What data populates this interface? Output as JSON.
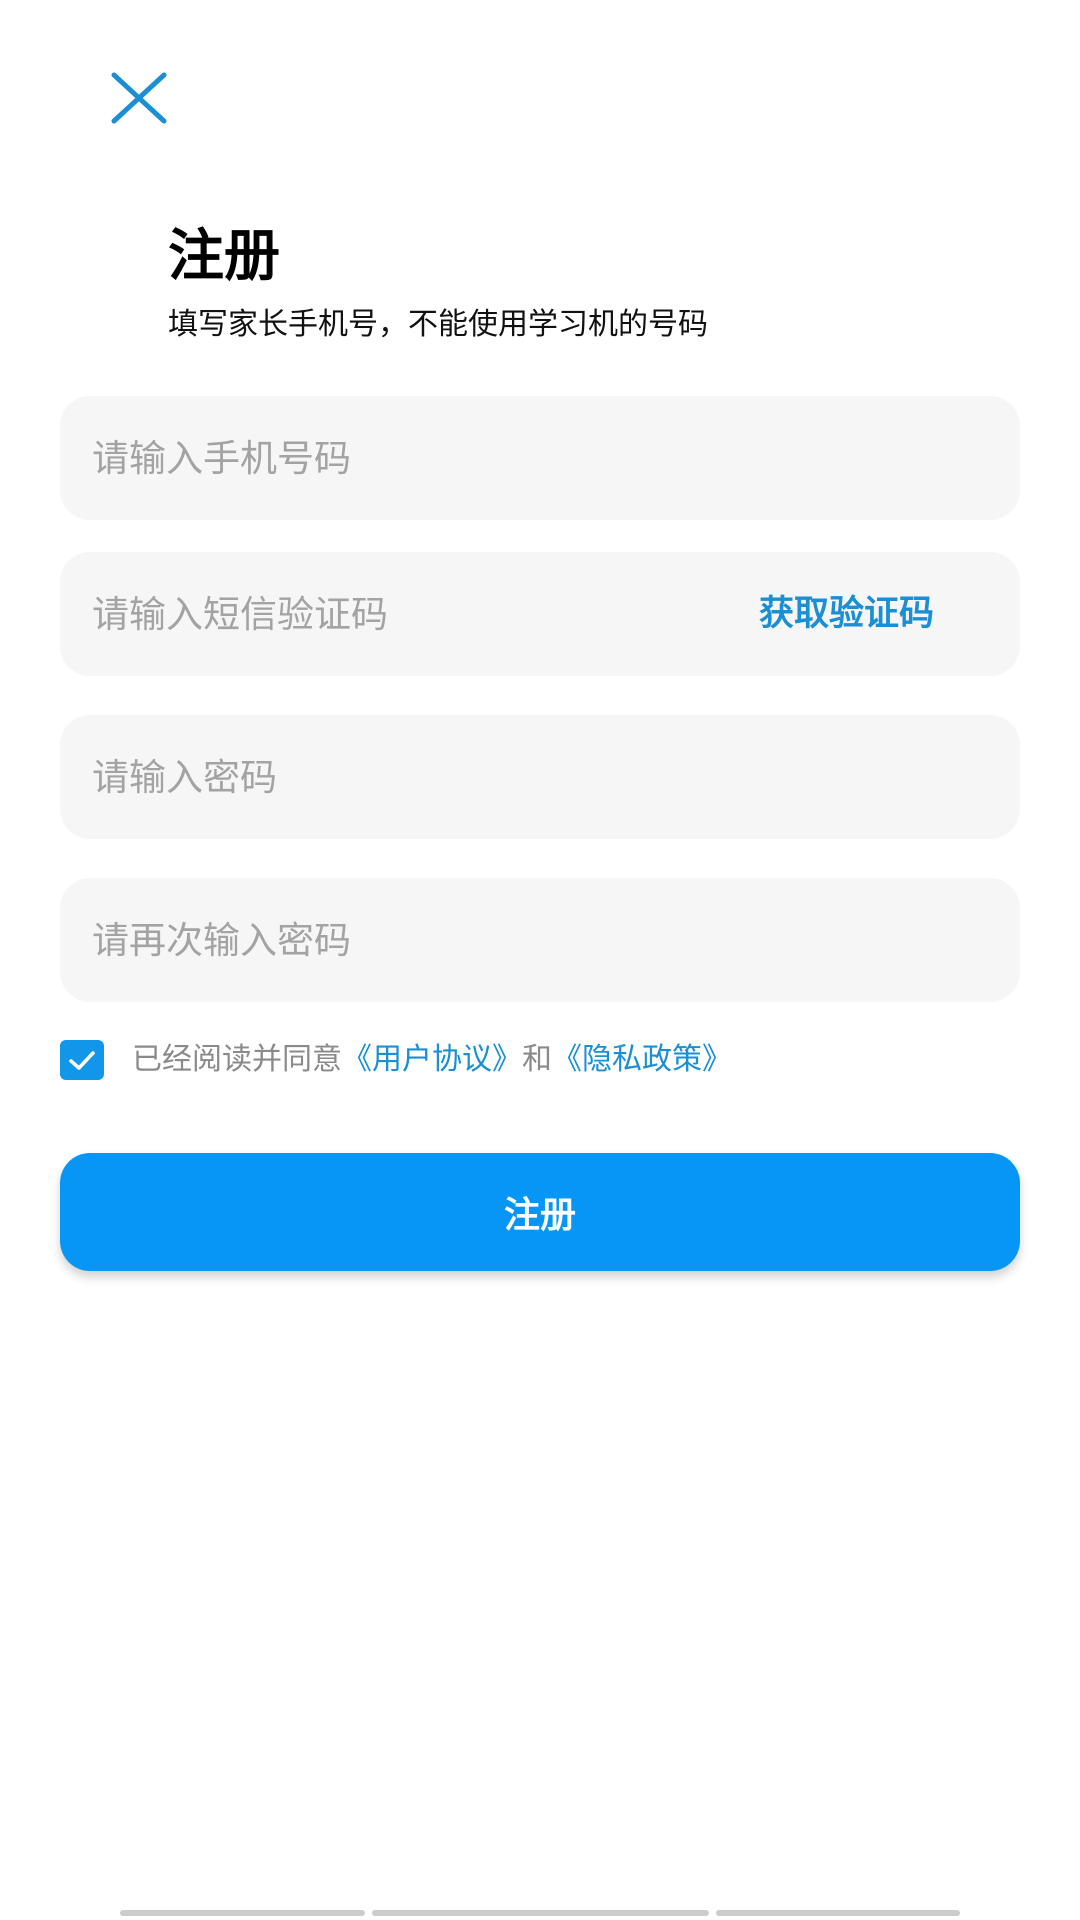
{
  "header": {
    "close_icon": "close-icon",
    "title": "注册",
    "subtitle": "填写家长手机号，不能使用学习机的号码"
  },
  "form": {
    "phone_placeholder": "请输入手机号码",
    "code_placeholder": "请输入短信验证码",
    "get_code_label": "获取验证码",
    "password_placeholder": "请输入密码",
    "password_confirm_placeholder": "请再次输入密码"
  },
  "agreement": {
    "checked": true,
    "prefix": "已经阅读并同意",
    "user_agreement_link": "《用户协议》",
    "conjunction": "和",
    "privacy_policy_link": "《隐私政策》"
  },
  "submit": {
    "label": "注册"
  },
  "colors": {
    "accent": "#0796f6",
    "link": "#1a8fd6",
    "field_background": "#f6f6f6",
    "placeholder": "#a3a3a3"
  }
}
